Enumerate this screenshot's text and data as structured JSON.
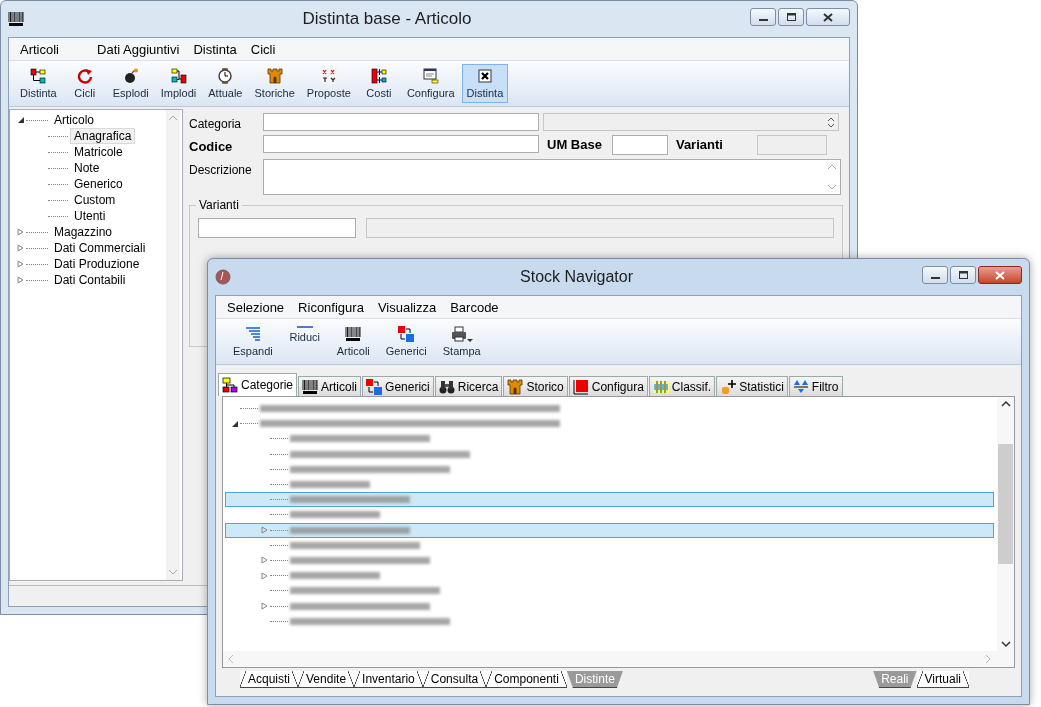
{
  "back_window": {
    "title": "Distinta base - Articolo",
    "menu": [
      "Articoli",
      "Dati Aggiuntivi",
      "Distinta",
      "Cicli"
    ],
    "toolbar": [
      {
        "label": "Distinta",
        "selected": false
      },
      {
        "label": "Cicli",
        "selected": false
      },
      {
        "label": "Esplodi",
        "selected": false
      },
      {
        "label": "Implodi",
        "selected": false
      },
      {
        "label": "Attuale",
        "selected": false
      },
      {
        "label": "Storiche",
        "selected": false
      },
      {
        "label": "Proposte",
        "selected": false
      },
      {
        "label": "Costi",
        "selected": false
      },
      {
        "label": "Configura",
        "selected": false
      },
      {
        "label": "Distinta",
        "selected": true
      }
    ],
    "tree": [
      {
        "label": "Articolo",
        "expanded": true,
        "selected": false,
        "children": [
          {
            "label": "Anagrafica",
            "selected": true
          },
          {
            "label": "Matricole",
            "selected": false
          },
          {
            "label": "Note",
            "selected": false
          },
          {
            "label": "Generico",
            "selected": false
          },
          {
            "label": "Custom",
            "selected": false
          },
          {
            "label": "Utenti",
            "selected": false
          }
        ]
      },
      {
        "label": "Magazzino",
        "expanded": false,
        "selected": false
      },
      {
        "label": "Dati Commerciali",
        "expanded": false,
        "selected": false
      },
      {
        "label": "Dati Produzione",
        "expanded": false,
        "selected": false
      },
      {
        "label": "Dati Contabili",
        "expanded": false,
        "selected": false
      }
    ],
    "form": {
      "categoria_label": "Categoria",
      "codice_label": "Codice",
      "um_base_label": "UM Base",
      "varianti_label": "Varianti",
      "descrizione_label": "Descrizione",
      "group_title": "Varianti"
    }
  },
  "front_window": {
    "title": "Stock Navigator",
    "menu": [
      "Selezione",
      "Riconfigura",
      "Visualizza",
      "Barcode"
    ],
    "toolbar": [
      "Espandi",
      "Riduci",
      "Articoli",
      "Generici",
      "Stampa"
    ],
    "tabs": [
      {
        "label": "Categorie",
        "selected": true
      },
      {
        "label": "Articoli",
        "selected": false
      },
      {
        "label": "Generici",
        "selected": false
      },
      {
        "label": "Ricerca",
        "selected": false
      },
      {
        "label": "Storico",
        "selected": false
      },
      {
        "label": "Configura",
        "selected": false
      },
      {
        "label": "Classif.",
        "selected": false
      },
      {
        "label": "Statistici",
        "selected": false
      },
      {
        "label": "Filtro",
        "selected": false
      }
    ],
    "tree": [
      {
        "kind": "leaf",
        "selected": false
      },
      {
        "kind": "branch",
        "expanded": true,
        "selected": false,
        "children": [
          {
            "kind": "leaf",
            "selected": false
          },
          {
            "kind": "leaf",
            "selected": false
          },
          {
            "kind": "leaf",
            "selected": false
          },
          {
            "kind": "leaf",
            "selected": false
          },
          {
            "kind": "leaf",
            "selected": true
          },
          {
            "kind": "leaf",
            "selected": false
          },
          {
            "kind": "folder",
            "selected": true
          },
          {
            "kind": "leaf",
            "selected": false
          },
          {
            "kind": "folder",
            "selected": false
          },
          {
            "kind": "folder",
            "selected": false
          },
          {
            "kind": "leaf",
            "selected": false
          },
          {
            "kind": "folder",
            "selected": false
          },
          {
            "kind": "leaf",
            "selected": false
          }
        ]
      }
    ],
    "bottom_tabs": [
      {
        "label": "Acquisti",
        "selected": false
      },
      {
        "label": "Vendite",
        "selected": false
      },
      {
        "label": "Inventario",
        "selected": false
      },
      {
        "label": "Consulta",
        "selected": false
      },
      {
        "label": "Componenti",
        "selected": false
      },
      {
        "label": "Distinte",
        "selected": true
      }
    ],
    "view_tabs": [
      {
        "label": "Reali",
        "selected": true
      },
      {
        "label": "Virtuali",
        "selected": false
      }
    ]
  }
}
